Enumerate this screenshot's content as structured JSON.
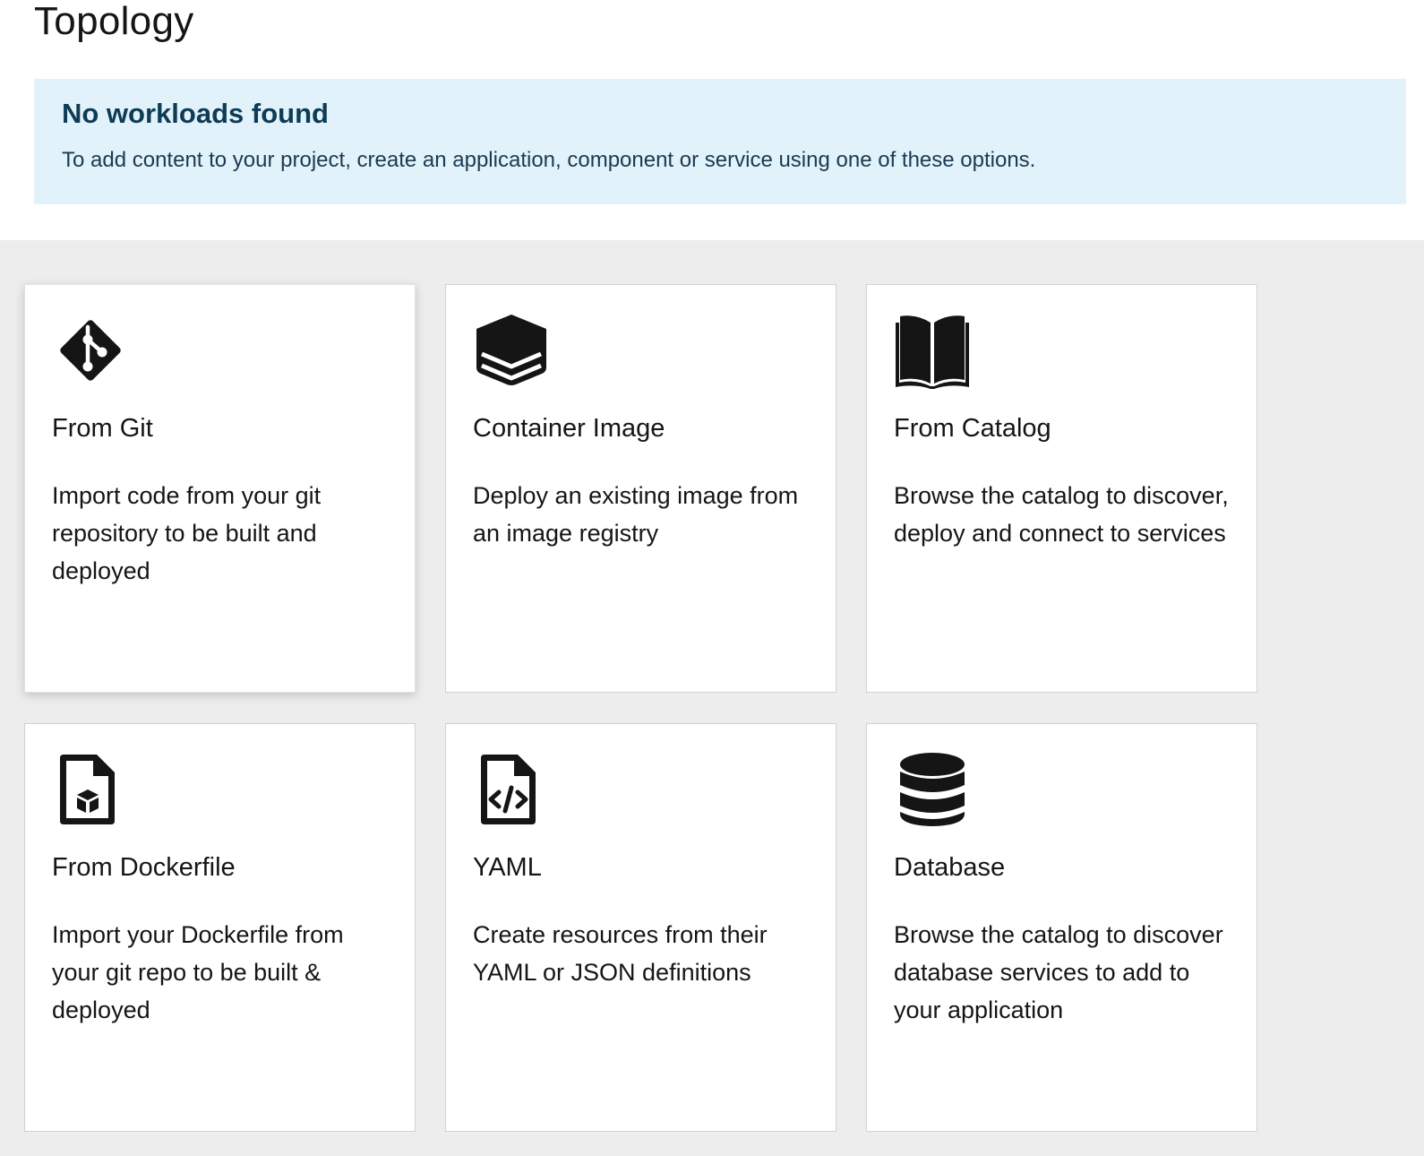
{
  "page": {
    "title": "Topology"
  },
  "alert": {
    "title": "No workloads found",
    "body": "To add content to your project, create an application, component or service using one of these options."
  },
  "colors": {
    "alert_background": "#e1f2fb",
    "alert_title": "#0f3b55",
    "content_background": "#ededed",
    "card_background": "#ffffff",
    "icon": "#151515"
  },
  "cards": [
    {
      "title": "From Git",
      "description": "Import code from your git repository to be built and deployed",
      "icon": "git-icon"
    },
    {
      "title": "Container Image",
      "description": "Deploy an existing image from an image registry",
      "icon": "layers-icon"
    },
    {
      "title": "From Catalog",
      "description": "Browse the catalog to discover, deploy and connect to services",
      "icon": "book-icon"
    },
    {
      "title": "From Dockerfile",
      "description": "Import your Dockerfile from your git repo to be built & deployed",
      "icon": "dockerfile-icon"
    },
    {
      "title": "YAML",
      "description": "Create resources from their YAML or JSON definitions",
      "icon": "yaml-file-icon"
    },
    {
      "title": "Database",
      "description": "Browse the catalog to discover database services to add to your application",
      "icon": "database-icon"
    }
  ]
}
